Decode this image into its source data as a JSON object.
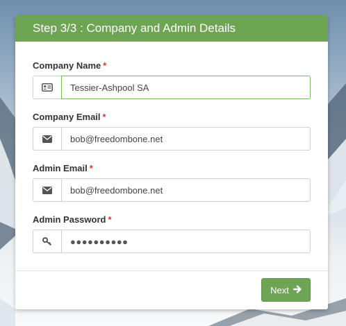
{
  "header": {
    "title": "Step 3/3 : Company and Admin Details"
  },
  "fields": [
    {
      "label": "Company Name",
      "required": "*",
      "value": "Tessier-Ashpool SA",
      "icon": "id-card-icon"
    },
    {
      "label": "Company Email",
      "required": "*",
      "value": "bob@freedombone.net",
      "icon": "envelope-icon"
    },
    {
      "label": "Admin Email",
      "required": "*",
      "value": "bob@freedombone.net",
      "icon": "envelope-icon"
    },
    {
      "label": "Admin Password",
      "required": "*",
      "value": "●●●●●●●●●●",
      "icon": "key-icon"
    }
  ],
  "footer": {
    "next_label": "Next"
  },
  "colors": {
    "accent": "#6ea555",
    "required": "#d9342b"
  }
}
